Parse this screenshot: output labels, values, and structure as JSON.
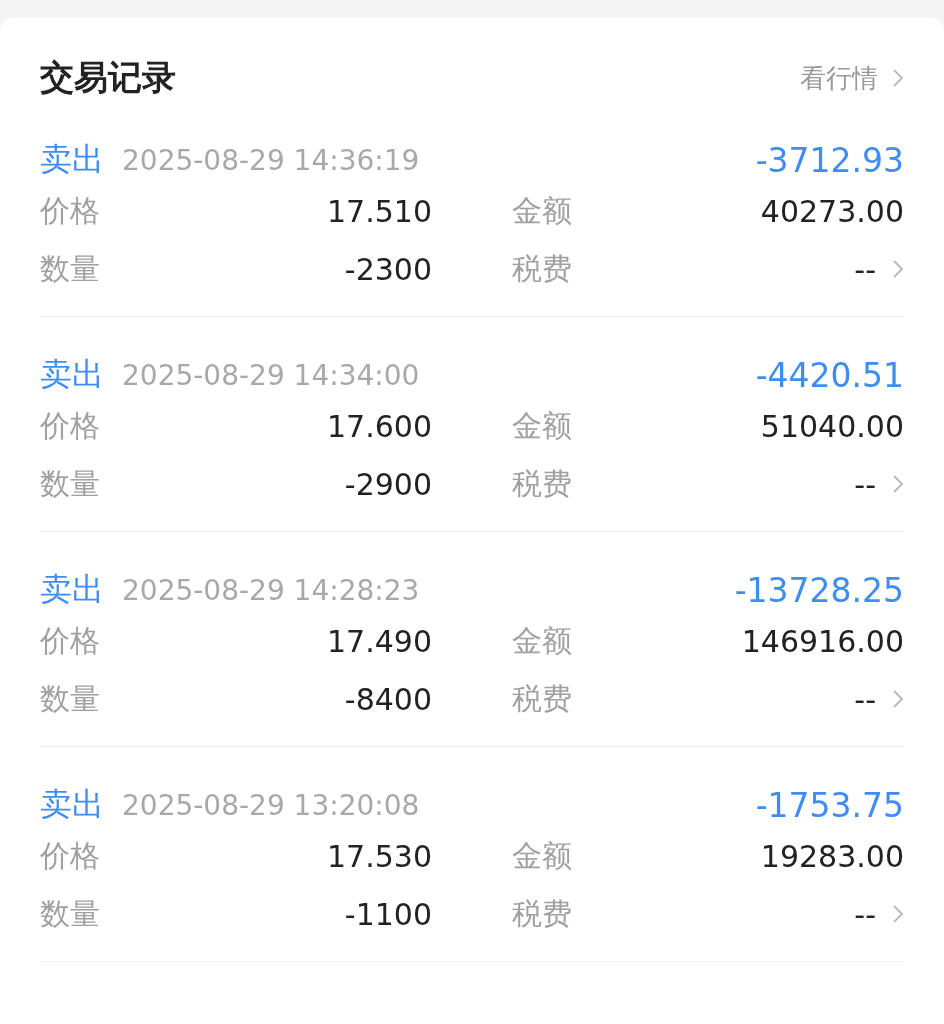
{
  "header": {
    "title": "交易记录",
    "link": "看行情"
  },
  "records": [
    {
      "kind": "sell",
      "side": "卖出",
      "time": "2025-08-29 14:36:19",
      "change": "-3712.93",
      "price_label": "价格",
      "price": "17.510",
      "amount_label": "金额",
      "amount": "40273.00",
      "qty_label": "数量",
      "qty": "-2300",
      "tax_label": "税费",
      "tax": "--"
    },
    {
      "kind": "sell",
      "side": "卖出",
      "time": "2025-08-29 14:34:00",
      "change": "-4420.51",
      "price_label": "价格",
      "price": "17.600",
      "amount_label": "金额",
      "amount": "51040.00",
      "qty_label": "数量",
      "qty": "-2900",
      "tax_label": "税费",
      "tax": "--"
    },
    {
      "kind": "sell",
      "side": "卖出",
      "time": "2025-08-29 14:28:23",
      "change": "-13728.25",
      "price_label": "价格",
      "price": "17.490",
      "amount_label": "金额",
      "amount": "146916.00",
      "qty_label": "数量",
      "qty": "-8400",
      "tax_label": "税费",
      "tax": "--"
    },
    {
      "kind": "sell",
      "side": "卖出",
      "time": "2025-08-29 13:20:08",
      "change": "-1753.75",
      "price_label": "价格",
      "price": "17.530",
      "amount_label": "金额",
      "amount": "19283.00",
      "qty_label": "数量",
      "qty": "-1100",
      "tax_label": "税费",
      "tax": "--"
    }
  ]
}
